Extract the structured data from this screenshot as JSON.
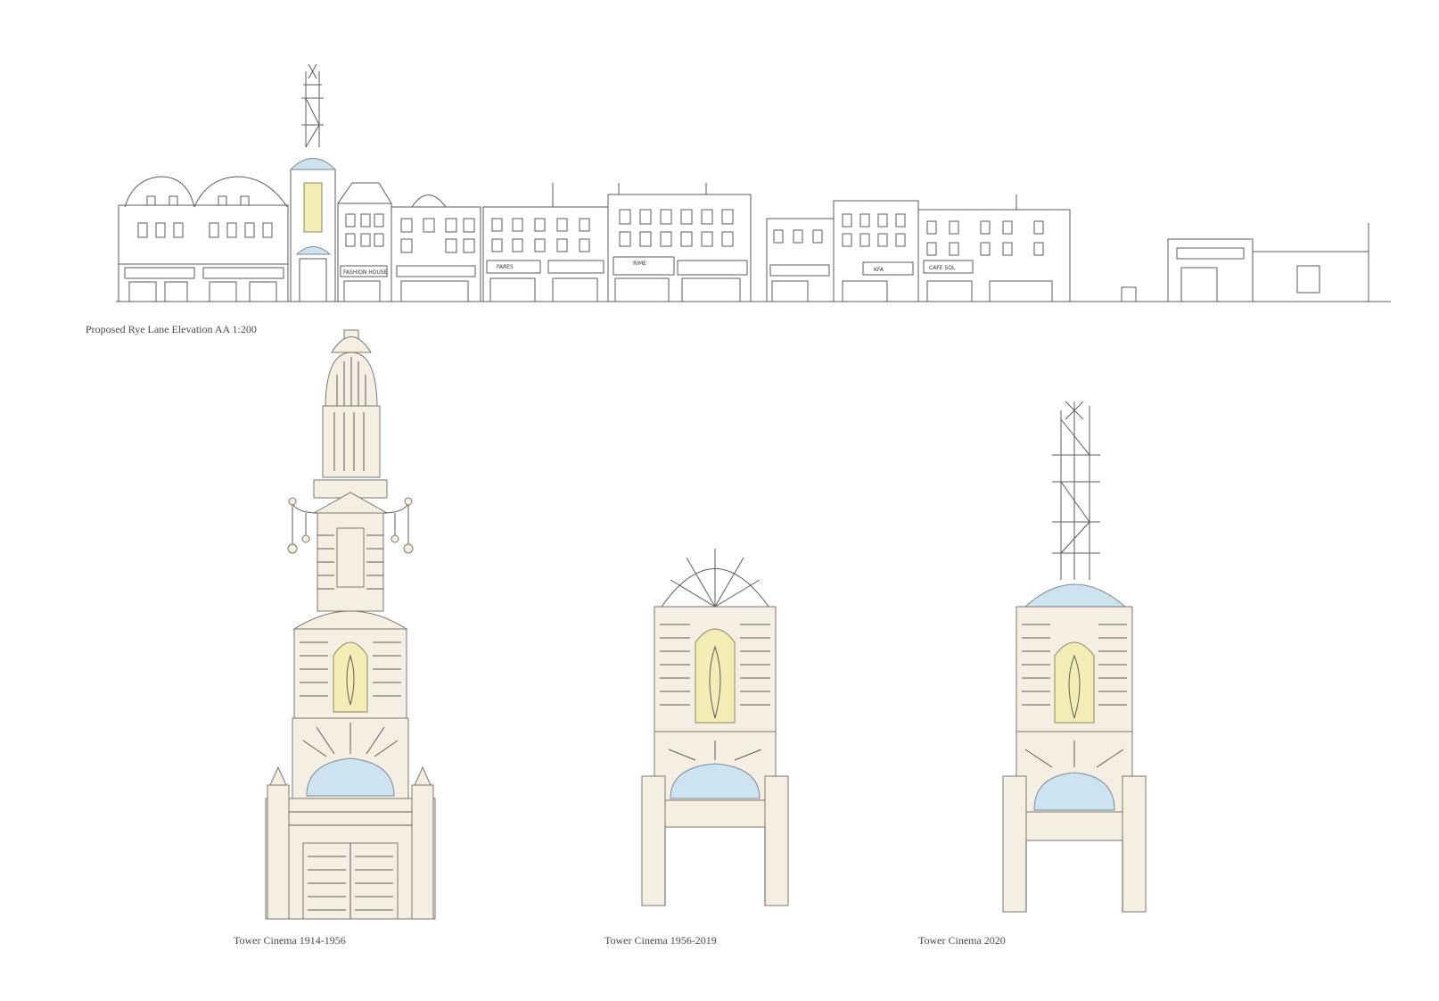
{
  "captions": {
    "elevation": "Proposed Rye Lane Elevation AA 1:200",
    "tower_1914": "Tower Cinema 1914-1956",
    "tower_1956": "Tower Cinema 1956-2019",
    "tower_2020": "Tower Cinema 2020"
  },
  "shop_signs": [
    "FASHION HOUSE",
    "FARES",
    "RIME",
    "KFA",
    "CAFE SOL"
  ],
  "colors": {
    "cream": "#f4efe2",
    "pale_blue": "#cde3ef",
    "pale_yellow": "#f3ecb5",
    "line": "#5b5b5b"
  }
}
